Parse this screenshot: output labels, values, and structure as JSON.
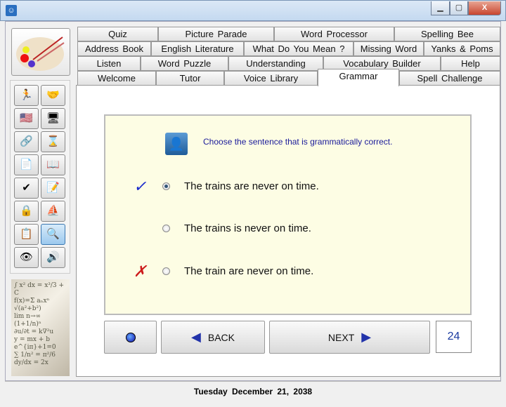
{
  "window": {
    "minimize": "▁",
    "maximize": "▢",
    "close": "X"
  },
  "tabs": {
    "row1": [
      "Quiz",
      "Picture Parade",
      "Word Processor",
      "Spelling Bee"
    ],
    "row2": [
      "Address Book",
      "English  Literature",
      "What  Do  You  Mean ?",
      "Missing Word",
      "Yanks  &  Poms"
    ],
    "row3": [
      "Listen",
      "Word Puzzle",
      "Understanding",
      "Vocabulary Builder",
      "Help"
    ],
    "row4": [
      "Welcome",
      "Tutor",
      "Voice Library",
      "Grammar",
      "Spell Challenge"
    ],
    "selected": "Grammar"
  },
  "sidebar": {
    "icons": [
      "walker-icon",
      "hands-icon",
      "flags-icon",
      "monitor-icon",
      "chain-document-icon",
      "hourglass-icon",
      "document-mail-icon",
      "book-icon",
      "spellcheck-icon",
      "hand-document-icon",
      "lock-icon",
      "sailboat-icon",
      "notepad-icon",
      "search-document-icon",
      "eye-icon",
      "speaker-icon"
    ],
    "icon_glyphs": [
      "🏃",
      "🤝",
      "🇺🇸",
      "🖥",
      "🔗",
      "⌛",
      "📄",
      "📖",
      "✔",
      "📝",
      "🔒",
      "⛵",
      "📋",
      "🔍",
      "👁",
      "🔊"
    ]
  },
  "question": {
    "prompt": "Choose the sentence that is grammatically correct.",
    "options": [
      {
        "text": "The trains are never on time.",
        "selected": true,
        "mark": "✓"
      },
      {
        "text": "The trains is never on time.",
        "selected": false,
        "mark": ""
      },
      {
        "text": "The train are never on time.",
        "selected": false,
        "mark": "✗"
      }
    ]
  },
  "nav": {
    "back": "BACK",
    "next": "NEXT",
    "counter": "24"
  },
  "status": {
    "date": "Tuesday  December 21, 2038"
  },
  "colors": {
    "check": "#1a2acc",
    "cross": "#cc1a1a"
  }
}
